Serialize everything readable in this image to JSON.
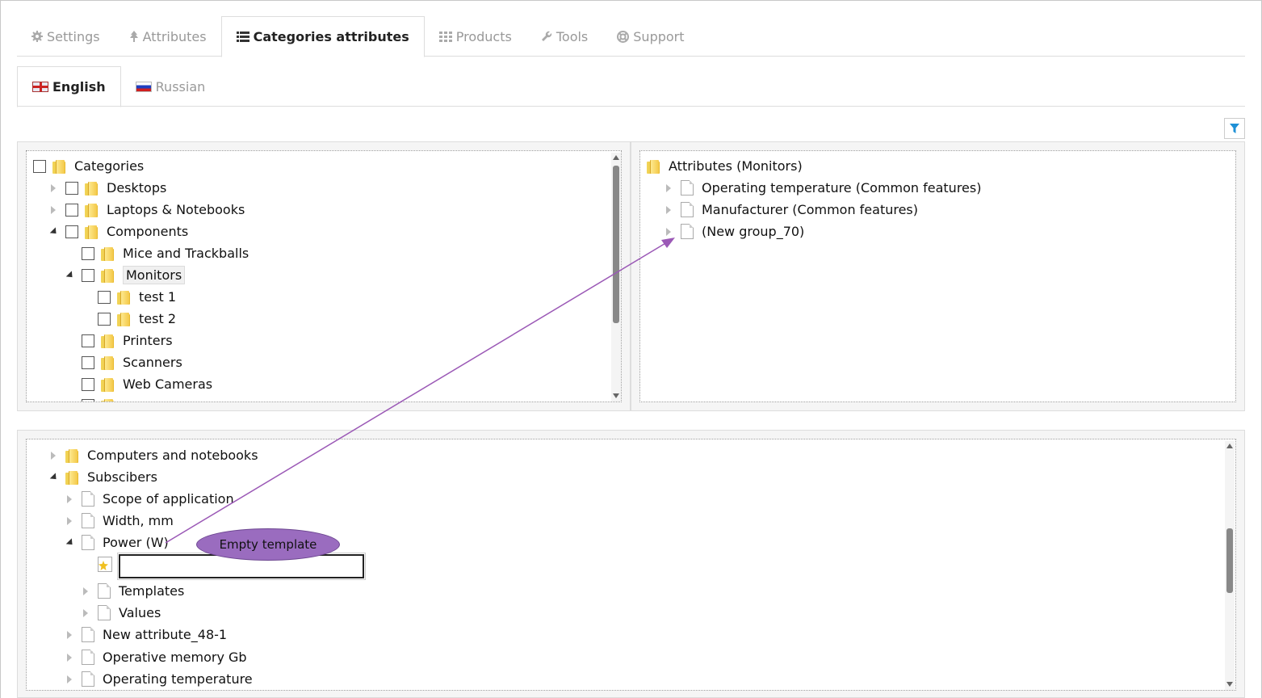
{
  "main_tabs": [
    {
      "label": "Settings",
      "icon": "gear-icon"
    },
    {
      "label": "Attributes",
      "icon": "tree-icon"
    },
    {
      "label": "Categories attributes",
      "icon": "list-icon",
      "active": true
    },
    {
      "label": "Products",
      "icon": "grid-icon"
    },
    {
      "label": "Tools",
      "icon": "wrench-icon"
    },
    {
      "label": "Support",
      "icon": "lifebuoy-icon"
    }
  ],
  "language_tabs": [
    {
      "label": "English",
      "icon": "uk-flag-icon",
      "active": true
    },
    {
      "label": "Russian",
      "icon": "russia-flag-icon"
    }
  ],
  "filter_button": {
    "icon": "filter-icon",
    "color": "#1e90d6"
  },
  "categories_tree": {
    "root": "Categories",
    "items": [
      "Desktops",
      "Laptops & Notebooks",
      "Components",
      "Mice and Trackballs",
      "Monitors",
      "test 1",
      "test 2",
      "Printers",
      "Scanners",
      "Web Cameras"
    ],
    "selected": "Monitors"
  },
  "attributes_tree": {
    "root": "Attributes (Monitors)",
    "items": [
      "Operating temperature (Common features)",
      "Manufacturer (Common features)",
      "(New group_70)"
    ]
  },
  "bottom_tree": {
    "items": [
      "Computers and notebooks",
      "Subscibers",
      "Scope of application",
      "Width, mm",
      "Power (W)",
      "Templates",
      "Values",
      "New attribute_48-1",
      "Operative memory Gb",
      "Operating temperature"
    ],
    "new_template_value": ""
  },
  "callout": {
    "text": "Empty template",
    "color": "#9a6cbf"
  },
  "arrow_color": "#9b59b6"
}
